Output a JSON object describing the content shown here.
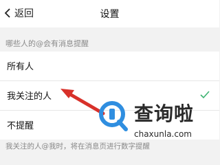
{
  "navbar": {
    "back_label": "返回",
    "title": "设置"
  },
  "section": {
    "header": "哪些人的@会有消息提醒"
  },
  "options": [
    {
      "label": "所有人",
      "selected": false
    },
    {
      "label": "我关注的人",
      "selected": true
    },
    {
      "label": "不提醒",
      "selected": false
    }
  ],
  "footer": {
    "note": "我关注的人@我时，将在消息页进行数字提醒"
  },
  "watermark": {
    "brand": "查询啦",
    "domain": "chaxunla.com"
  },
  "colors": {
    "accent_check": "#3cb371",
    "arrow": "#d8312a",
    "logo_blue": "#2f8ee0"
  }
}
